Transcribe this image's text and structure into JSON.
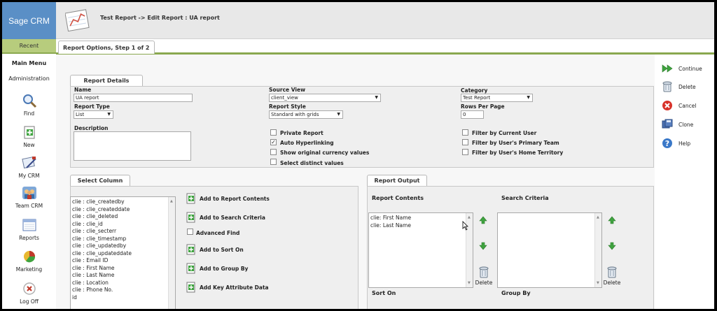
{
  "brand": "Sage CRM",
  "header": {
    "title": "Test Report -> Edit Report : UA report"
  },
  "tabs": {
    "recent": "Recent",
    "report_options": "Report Options, Step 1 of 2"
  },
  "nav": {
    "main_menu": "Main Menu",
    "administration": "Administration",
    "items": [
      {
        "label": "Find",
        "icon": "magnifier-icon"
      },
      {
        "label": "New",
        "icon": "new-document-icon"
      },
      {
        "label": "My CRM",
        "icon": "my-crm-icon"
      },
      {
        "label": "Team CRM",
        "icon": "team-icon"
      },
      {
        "label": "Reports",
        "icon": "reports-icon"
      },
      {
        "label": "Marketing",
        "icon": "pie-chart-icon"
      },
      {
        "label": "Log Off",
        "icon": "log-off-icon"
      }
    ]
  },
  "report_details": {
    "tab": "Report Details",
    "name_label": "Name",
    "name_value": "UA report",
    "source_view_label": "Source View",
    "source_view_value": "client_view",
    "category_label": "Category",
    "category_value": "Test Report",
    "report_type_label": "Report Type",
    "report_type_value": "List",
    "report_style_label": "Report Style",
    "report_style_value": "Standard with grids",
    "rows_per_page_label": "Rows Per Page",
    "rows_per_page_value": "0",
    "description_label": "Description",
    "description_value": "",
    "checkboxes_mid": [
      {
        "label": "Private Report",
        "checked": false
      },
      {
        "label": "Auto Hyperlinking",
        "checked": true
      },
      {
        "label": "Show original currency values",
        "checked": false
      },
      {
        "label": "Select distinct values",
        "checked": false
      }
    ],
    "checkboxes_right": [
      {
        "label": "Filter by Current User",
        "checked": false
      },
      {
        "label": "Filter by User's Primary Team",
        "checked": false
      },
      {
        "label": "Filter by User's Home Territory",
        "checked": false
      }
    ]
  },
  "select_column": {
    "tab": "Select Column",
    "columns": [
      "clie : clie_createdby",
      "clie : clie_createddate",
      "clie : clie_deleted",
      "clie : clie_id",
      "clie : clie_secterr",
      "clie : clie_timestamp",
      "clie : clie_updatedby",
      "clie : clie_updateddate",
      "clie : Email ID",
      "clie : First Name",
      "clie : Last Name",
      "clie : Location",
      "clie : Phone No.",
      "id"
    ],
    "actions": {
      "add_report_contents": "Add to Report Contents",
      "add_search_criteria": "Add to Search Criteria",
      "advanced_find": "Advanced Find",
      "add_sort_on": "Add to Sort On",
      "add_group_by": "Add to Group By",
      "add_key_attribute": "Add Key Attribute Data"
    }
  },
  "report_output": {
    "tab": "Report Output",
    "report_contents_label": "Report Contents",
    "search_criteria_label": "Search Criteria",
    "report_contents": [
      "clie: First Name",
      "clie: Last Name"
    ],
    "delete_label": "Delete",
    "sort_on_label": "Sort On",
    "group_by_label": "Group By"
  },
  "right_actions": {
    "continue": "Continue",
    "delete": "Delete",
    "cancel": "Cancel",
    "clone": "Clone",
    "help": "Help"
  }
}
